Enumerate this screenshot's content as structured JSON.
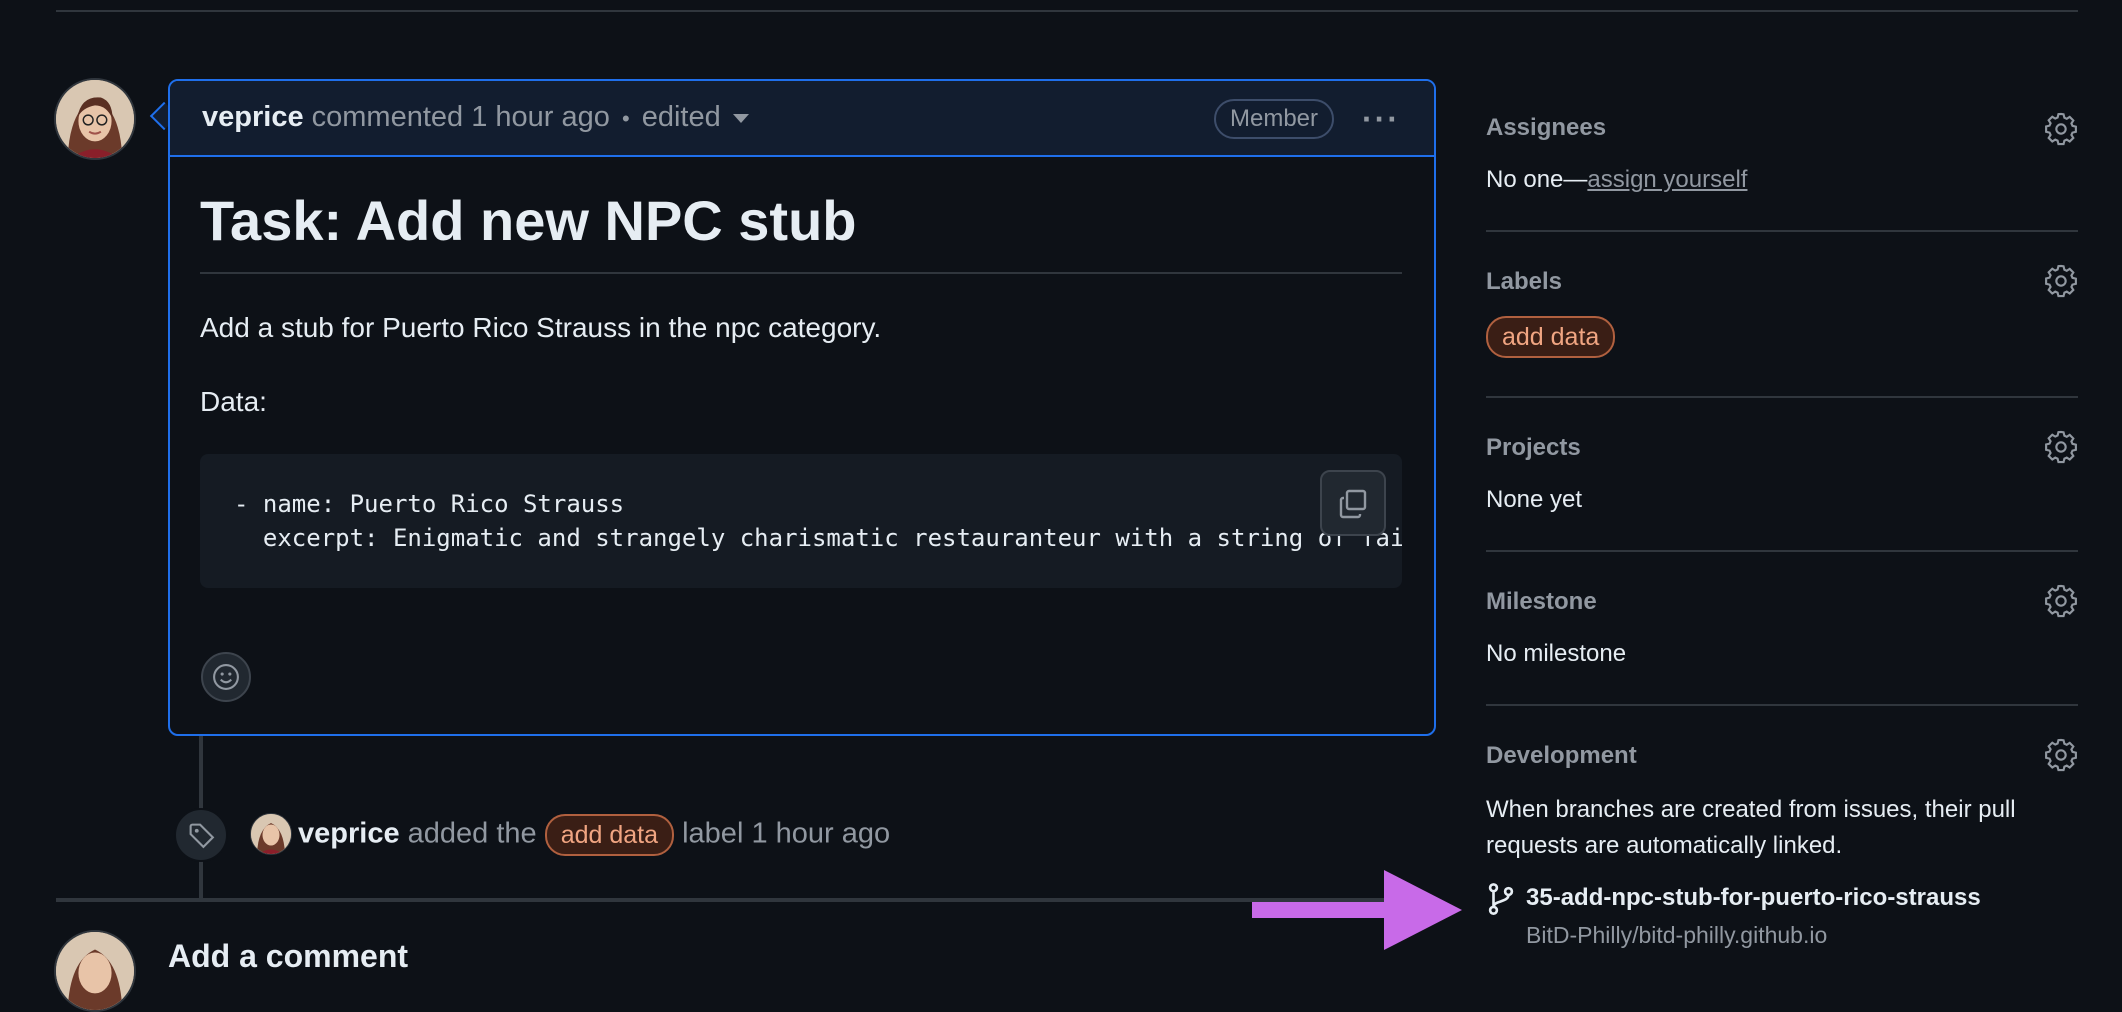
{
  "comment": {
    "author": "veprice",
    "meta": "commented 1 hour ago",
    "separator": "•",
    "edited": "edited",
    "badge": "Member",
    "more": "···",
    "title": "Task: Add new NPC stub",
    "body_line1": "Add a stub for Puerto Rico Strauss in the npc category.",
    "body_line2": "Data:",
    "code_line1": "- name: Puerto Rico Strauss",
    "code_line2": "  excerpt: Enigmatic and strangely charismatic restauranteur with a string of fail"
  },
  "event": {
    "author": "veprice",
    "action": "added the",
    "label": "add data",
    "suffix": "label 1 hour ago"
  },
  "add_comment": {
    "heading": "Add a comment"
  },
  "sidebar": {
    "assignees": {
      "heading": "Assignees",
      "value_prefix": "No one—",
      "link": "assign yourself"
    },
    "labels": {
      "heading": "Labels",
      "label": "add data"
    },
    "projects": {
      "heading": "Projects",
      "value": "None yet"
    },
    "milestone": {
      "heading": "Milestone",
      "value": "No milestone"
    },
    "development": {
      "heading": "Development",
      "text": "When branches are created from issues, their pull requests are automatically linked.",
      "branch": "35-add-npc-stub-for-puerto-rico-strauss",
      "repo": "BitD-Philly/bitd-philly.github.io"
    }
  },
  "colors": {
    "accent_border": "#1f6feb",
    "label_text": "#f0a582",
    "annotation_arrow": "#c86ae8"
  }
}
